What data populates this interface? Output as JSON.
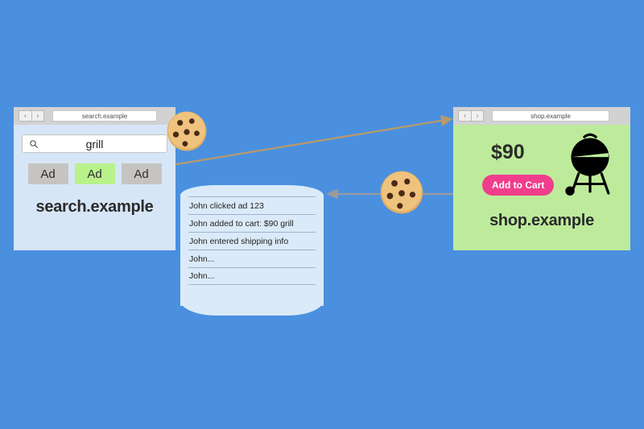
{
  "background_color": "#4a90df",
  "search_browser": {
    "name": "search-browser-window",
    "back_label": "‹",
    "forward_label": "›",
    "url": "search.example",
    "search": {
      "icon": "search-icon",
      "value": "grill",
      "placeholder": "Search"
    },
    "ads": [
      {
        "label": "Ad",
        "highlighted": false
      },
      {
        "label": "Ad",
        "highlighted": true
      },
      {
        "label": "Ad",
        "highlighted": false
      }
    ],
    "site_title": "search.example",
    "colors": {
      "page_background": "#d7e6f7",
      "ad_default": "#c6c4c2",
      "ad_highlight": "#b9f18b"
    }
  },
  "shop_browser": {
    "name": "shop-browser-window",
    "back_label": "‹",
    "forward_label": "›",
    "url": "shop.example",
    "price": "$90",
    "cart_button_label": "Add to Cart",
    "product_icon": "grill-icon",
    "site_title": "shop.example",
    "colors": {
      "page_background": "#bdeb9b",
      "cart_button": "#f03d8c"
    }
  },
  "database": {
    "name": "tracking-database",
    "rows": [
      "John clicked ad 123",
      "John added to cart: $90 grill",
      "John entered shipping info",
      "John...",
      "John..."
    ],
    "colors": {
      "fill": "#dbeaf8",
      "rule": "#9fb3c8"
    }
  },
  "cookies": [
    {
      "name": "cookie-on-search",
      "glyph": "🍪"
    },
    {
      "name": "cookie-on-shop",
      "glyph": "🍪"
    }
  ],
  "arrows": [
    {
      "name": "arrow-ad-to-shop",
      "color": "#b79a6c",
      "from": "ad-highlight",
      "to": "shop-browser-window"
    },
    {
      "name": "arrow-shop-to-database",
      "color": "#9a9a9a",
      "from": "add-to-cart-button",
      "to": "tracking-database"
    }
  ]
}
